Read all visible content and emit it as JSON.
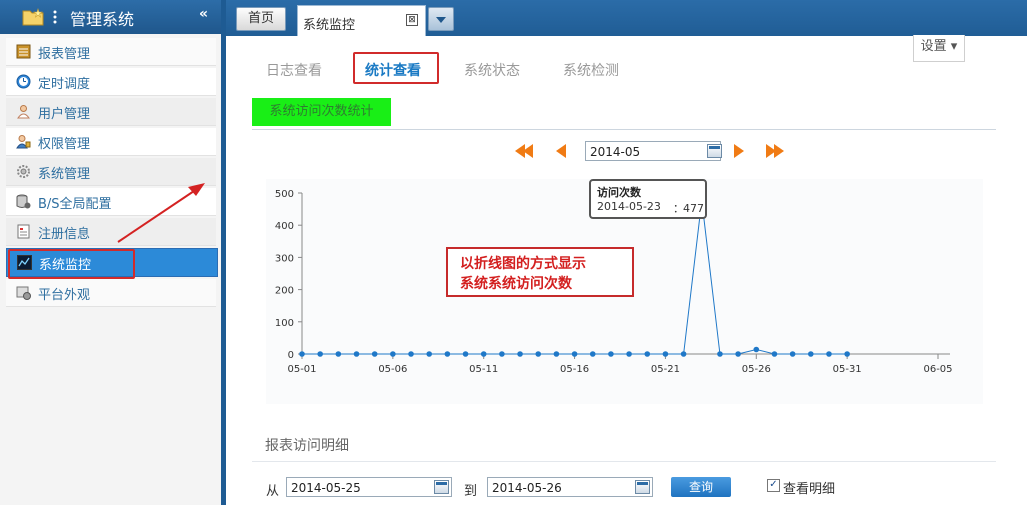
{
  "sidebar": {
    "title": "管理系统",
    "collapse": "«",
    "items": [
      {
        "label": "报表管理",
        "icon": "report-icon"
      },
      {
        "label": "定时调度",
        "icon": "clock-icon"
      },
      {
        "label": "用户管理",
        "icon": "user-icon"
      },
      {
        "label": "权限管理",
        "icon": "permission-icon"
      },
      {
        "label": "系统管理",
        "icon": "gear-icon"
      },
      {
        "label": "B/S全局配置",
        "icon": "database-icon"
      },
      {
        "label": "注册信息",
        "icon": "register-icon"
      },
      {
        "label": "系统监控",
        "icon": "monitor-icon",
        "active": true
      },
      {
        "label": "平台外观",
        "icon": "appearance-icon"
      }
    ]
  },
  "tabs": {
    "home": "首页",
    "current": "系统监控",
    "close": "⊠"
  },
  "content": {
    "settings": "设置 ▾",
    "subtabs": [
      "日志查看",
      "统计查看",
      "系统状态",
      "系统检测"
    ],
    "section_label": "系统访问次数统计",
    "month_value": "2014-05",
    "detail_title": "报表访问明细",
    "from_label": "从",
    "from_value": "2014-05-25",
    "to_label": "到",
    "to_value": "2014-05-26",
    "query": "查询",
    "detail_checkbox": "查看明细",
    "detail_checked": "✓"
  },
  "annotation": {
    "line1": "以折线图的方式显示",
    "line2": "系统系统访问次数"
  },
  "chart_data": {
    "type": "line",
    "x": [
      "2014-05-01",
      "2014-05-02",
      "2014-05-03",
      "2014-05-04",
      "2014-05-05",
      "2014-05-06",
      "2014-05-07",
      "2014-05-08",
      "2014-05-09",
      "2014-05-10",
      "2014-05-11",
      "2014-05-12",
      "2014-05-13",
      "2014-05-14",
      "2014-05-15",
      "2014-05-16",
      "2014-05-17",
      "2014-05-18",
      "2014-05-19",
      "2014-05-20",
      "2014-05-21",
      "2014-05-22",
      "2014-05-23",
      "2014-05-24",
      "2014-05-25",
      "2014-05-26",
      "2014-05-27",
      "2014-05-28",
      "2014-05-29",
      "2014-05-30",
      "2014-05-31"
    ],
    "values": [
      0,
      0,
      0,
      0,
      0,
      0,
      0,
      0,
      0,
      0,
      0,
      0,
      0,
      0,
      0,
      0,
      0,
      0,
      0,
      0,
      0,
      0,
      477,
      0,
      0,
      14,
      0,
      0,
      0,
      0,
      0
    ],
    "xticks": [
      "05-01",
      "05-06",
      "05-11",
      "05-16",
      "05-21",
      "05-26",
      "05-31",
      "06-05"
    ],
    "yticks": [
      0,
      100,
      200,
      300,
      400,
      500
    ],
    "ylim": [
      0,
      500
    ],
    "tooltip": {
      "title": "访问次数",
      "date": "2014-05-23",
      "sep": "：",
      "value": "477"
    },
    "color": "#1f78c8"
  }
}
